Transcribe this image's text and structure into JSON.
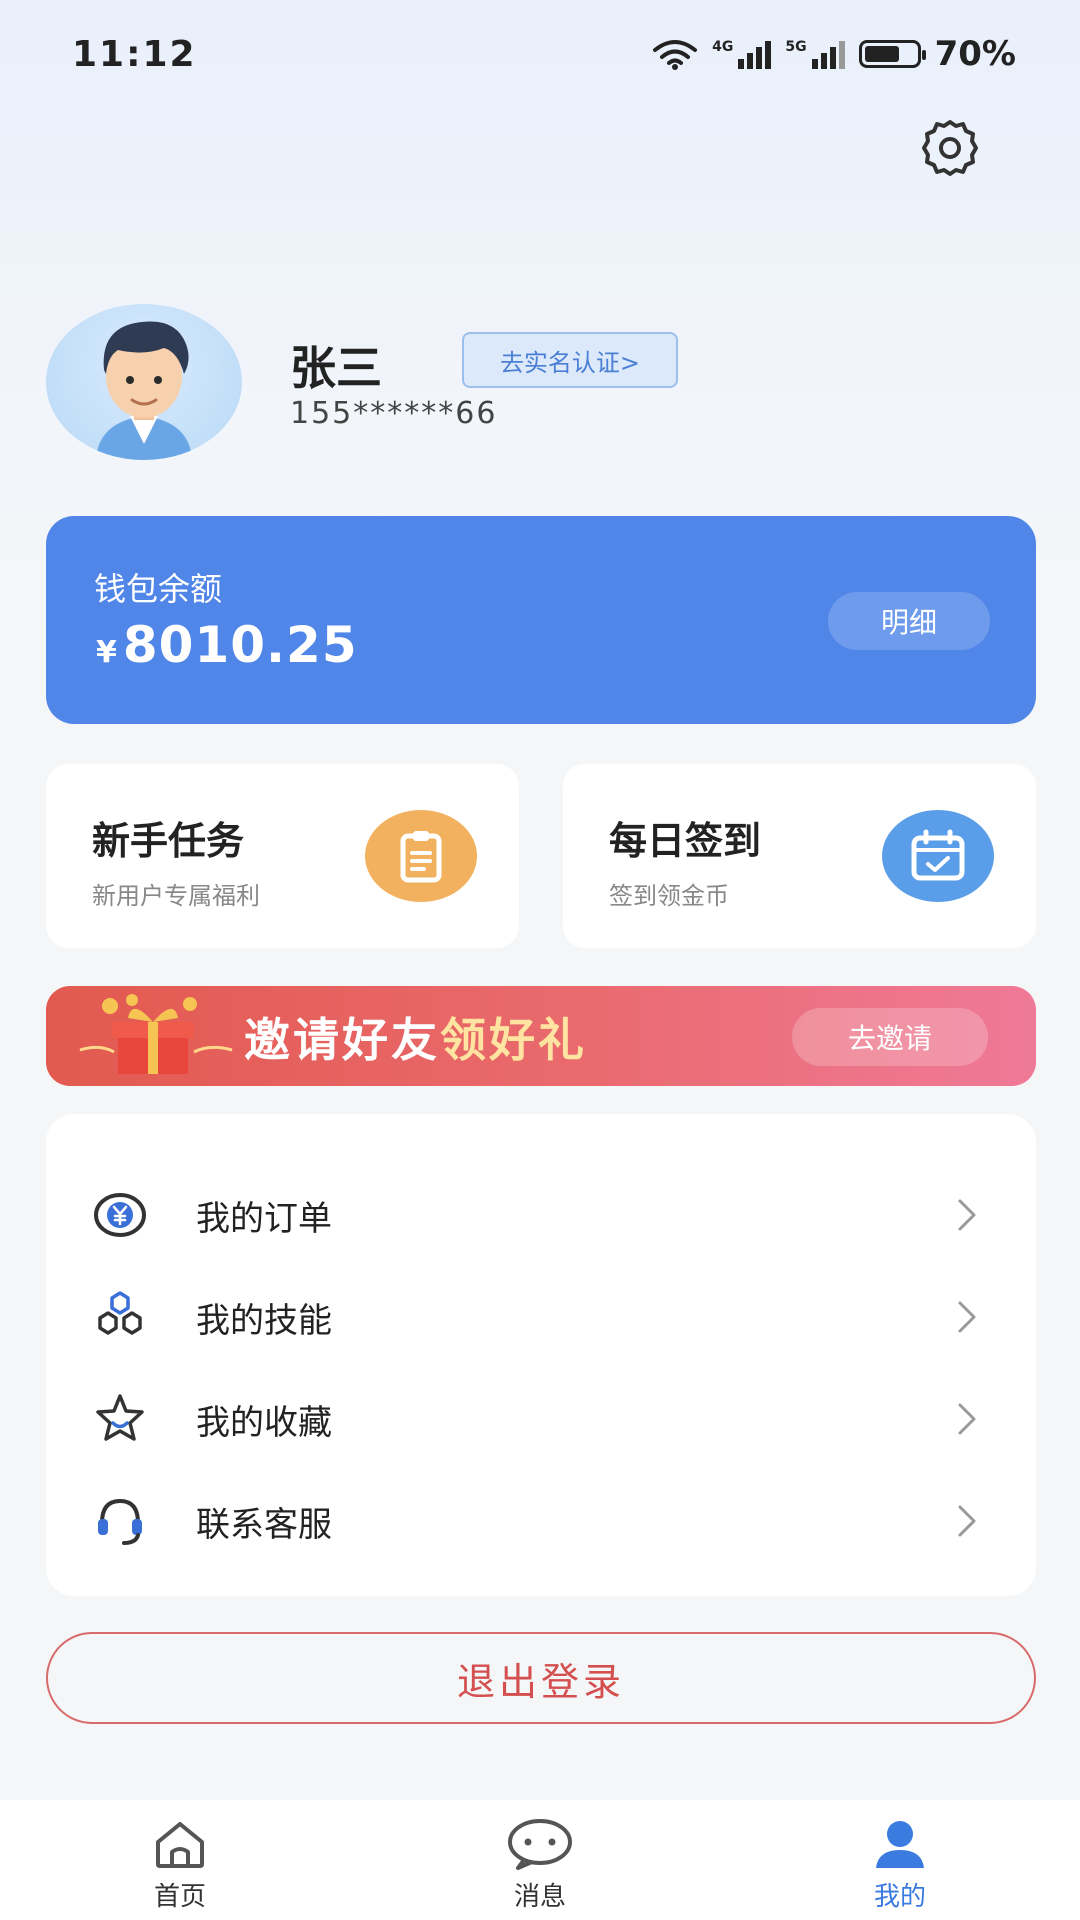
{
  "status_bar": {
    "time": "11:12",
    "net1": "4G",
    "net2": "5G",
    "battery": "70%"
  },
  "icons": {
    "settings": "gear-icon",
    "avatar": "avatar-illustration",
    "task": "clipboard-icon",
    "checkin": "calendar-check-icon",
    "orders": "yen-coin-icon",
    "skills": "hexagons-icon",
    "favorites": "star-icon",
    "support": "headset-icon",
    "arrow": "chevron-right-icon",
    "home": "home-icon",
    "messages": "chat-bubble-icon",
    "mine": "person-icon"
  },
  "colors": {
    "primary": "#4f86e8",
    "task_icon": "#f2b15e",
    "checkin_icon": "#5a9de8",
    "logout": "#d44f4f",
    "tab_active": "#3b7be0"
  },
  "profile": {
    "name": "张三",
    "verify_label": "去实名认证>",
    "phone": "155******66"
  },
  "wallet": {
    "label": "钱包余额",
    "currency": "¥",
    "amount": "8010.25",
    "detail_label": "明细"
  },
  "cards": [
    {
      "title": "新手任务",
      "subtitle": "新用户专属福利"
    },
    {
      "title": "每日签到",
      "subtitle": "签到领金币"
    }
  ],
  "invite": {
    "text_main": "邀请好友",
    "text_accent": "领好礼",
    "button": "去邀请"
  },
  "menu": [
    {
      "label": "我的订单"
    },
    {
      "label": "我的技能"
    },
    {
      "label": "我的收藏"
    },
    {
      "label": "联系客服"
    }
  ],
  "logout_label": "退出登录",
  "tabs": [
    {
      "label": "首页",
      "active": false
    },
    {
      "label": "消息",
      "active": false
    },
    {
      "label": "我的",
      "active": true
    }
  ]
}
